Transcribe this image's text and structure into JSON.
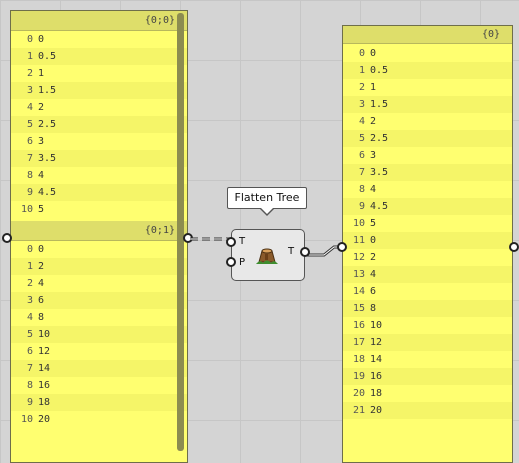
{
  "left_panel": {
    "branches": [
      {
        "path": "{0;0}",
        "items": [
          {
            "i": "0",
            "v": "0"
          },
          {
            "i": "1",
            "v": "0.5"
          },
          {
            "i": "2",
            "v": "1"
          },
          {
            "i": "3",
            "v": "1.5"
          },
          {
            "i": "4",
            "v": "2"
          },
          {
            "i": "5",
            "v": "2.5"
          },
          {
            "i": "6",
            "v": "3"
          },
          {
            "i": "7",
            "v": "3.5"
          },
          {
            "i": "8",
            "v": "4"
          },
          {
            "i": "9",
            "v": "4.5"
          },
          {
            "i": "10",
            "v": "5"
          }
        ]
      },
      {
        "path": "{0;1}",
        "items": [
          {
            "i": "0",
            "v": "0"
          },
          {
            "i": "1",
            "v": "2"
          },
          {
            "i": "2",
            "v": "4"
          },
          {
            "i": "3",
            "v": "6"
          },
          {
            "i": "4",
            "v": "8"
          },
          {
            "i": "5",
            "v": "10"
          },
          {
            "i": "6",
            "v": "12"
          },
          {
            "i": "7",
            "v": "14"
          },
          {
            "i": "8",
            "v": "16"
          },
          {
            "i": "9",
            "v": "18"
          },
          {
            "i": "10",
            "v": "20"
          }
        ]
      }
    ]
  },
  "component": {
    "tooltip": "Flatten Tree",
    "input_T": "T",
    "input_P": "P",
    "output_T": "T",
    "icon": "tree-stump-icon"
  },
  "right_panel": {
    "path": "{0}",
    "items": [
      {
        "i": "0",
        "v": "0"
      },
      {
        "i": "1",
        "v": "0.5"
      },
      {
        "i": "2",
        "v": "1"
      },
      {
        "i": "3",
        "v": "1.5"
      },
      {
        "i": "4",
        "v": "2"
      },
      {
        "i": "5",
        "v": "2.5"
      },
      {
        "i": "6",
        "v": "3"
      },
      {
        "i": "7",
        "v": "3.5"
      },
      {
        "i": "8",
        "v": "4"
      },
      {
        "i": "9",
        "v": "4.5"
      },
      {
        "i": "10",
        "v": "5"
      },
      {
        "i": "11",
        "v": "0"
      },
      {
        "i": "12",
        "v": "2"
      },
      {
        "i": "13",
        "v": "4"
      },
      {
        "i": "14",
        "v": "6"
      },
      {
        "i": "15",
        "v": "8"
      },
      {
        "i": "16",
        "v": "10"
      },
      {
        "i": "17",
        "v": "12"
      },
      {
        "i": "18",
        "v": "14"
      },
      {
        "i": "19",
        "v": "16"
      },
      {
        "i": "20",
        "v": "18"
      },
      {
        "i": "21",
        "v": "20"
      }
    ]
  },
  "colors": {
    "panel": "#ffff70",
    "header": "#dede6a",
    "canvas": "#d4d4d4"
  }
}
